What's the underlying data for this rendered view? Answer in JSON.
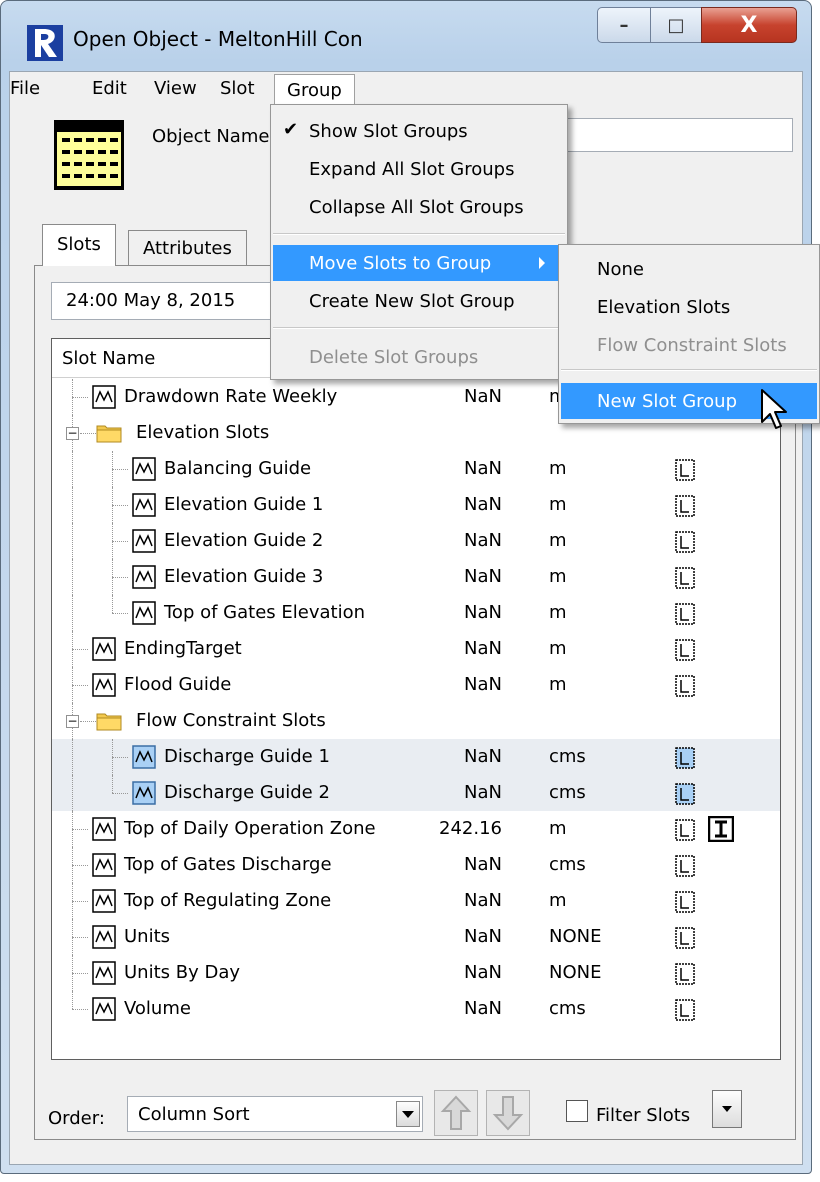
{
  "window": {
    "title": "Open Object - MeltonHill Con",
    "min_glyph": "–",
    "max_glyph": "□",
    "close_glyph": "X"
  },
  "menubar": [
    "File",
    "Edit",
    "View",
    "Slot",
    "Group"
  ],
  "object": {
    "label": "Object Name",
    "value": ""
  },
  "tabs": [
    "Slots",
    "Attributes"
  ],
  "date": "24:00 May 8, 2015",
  "list": {
    "header": "Slot Name",
    "rows": [
      {
        "name": "Drawdown Rate Weekly",
        "value": "NaN",
        "units": "m",
        "level": 0,
        "kind": "slot"
      },
      {
        "name": "Elevation Slots",
        "value": "",
        "units": "",
        "level": 0,
        "kind": "group"
      },
      {
        "name": "Balancing Guide",
        "value": "NaN",
        "units": "m",
        "level": 1,
        "kind": "slot"
      },
      {
        "name": "Elevation Guide 1",
        "value": "NaN",
        "units": "m",
        "level": 1,
        "kind": "slot"
      },
      {
        "name": "Elevation Guide 2",
        "value": "NaN",
        "units": "m",
        "level": 1,
        "kind": "slot"
      },
      {
        "name": "Elevation Guide 3",
        "value": "NaN",
        "units": "m",
        "level": 1,
        "kind": "slot"
      },
      {
        "name": "Top of Gates Elevation",
        "value": "NaN",
        "units": "m",
        "level": 1,
        "kind": "slot"
      },
      {
        "name": "EndingTarget",
        "value": "NaN",
        "units": "m",
        "level": 0,
        "kind": "slot"
      },
      {
        "name": "Flood Guide",
        "value": "NaN",
        "units": "m",
        "level": 0,
        "kind": "slot"
      },
      {
        "name": "Flow Constraint Slots",
        "value": "",
        "units": "",
        "level": 0,
        "kind": "group"
      },
      {
        "name": "Discharge Guide 1",
        "value": "NaN",
        "units": "cms",
        "level": 1,
        "kind": "slot",
        "selected": true
      },
      {
        "name": "Discharge Guide 2",
        "value": "NaN",
        "units": "cms",
        "level": 1,
        "kind": "slot",
        "selected": true
      },
      {
        "name": "Top of Daily Operation Zone",
        "value": "242.16",
        "units": "m",
        "level": 0,
        "kind": "slot",
        "input": true
      },
      {
        "name": "Top of Gates Discharge",
        "value": "NaN",
        "units": "cms",
        "level": 0,
        "kind": "slot"
      },
      {
        "name": "Top of Regulating Zone",
        "value": "NaN",
        "units": "m",
        "level": 0,
        "kind": "slot"
      },
      {
        "name": "Units",
        "value": "NaN",
        "units": "NONE",
        "level": 0,
        "kind": "slot"
      },
      {
        "name": "Units By Day",
        "value": "NaN",
        "units": "NONE",
        "level": 0,
        "kind": "slot"
      },
      {
        "name": "Volume",
        "value": "NaN",
        "units": "cms",
        "level": 0,
        "kind": "slot"
      }
    ]
  },
  "order": {
    "label": "Order:",
    "value": "Column Sort"
  },
  "filter": {
    "label": "Filter Slots"
  },
  "group_menu": {
    "items": [
      {
        "label": "Show Slot Groups",
        "checked": true
      },
      {
        "label": "Expand All Slot Groups"
      },
      {
        "label": "Collapse All Slot Groups"
      },
      {
        "label": "Move Slots to Group",
        "highlighted": true,
        "submenu": true
      },
      {
        "label": "Create New Slot Group"
      },
      {
        "label": "Delete Slot Groups",
        "disabled": true
      }
    ]
  },
  "submenu": {
    "items": [
      {
        "label": "None"
      },
      {
        "label": "Elevation Slots"
      },
      {
        "label": "Flow Constraint Slots",
        "disabled": true
      },
      {
        "label": "New Slot Group",
        "highlighted": true
      }
    ]
  },
  "colors": {
    "highlight": "#3399ff",
    "selected_row": "#e9edf2",
    "slot_icon_selected": "#a9d0f5",
    "folder": "#f3c94e"
  }
}
